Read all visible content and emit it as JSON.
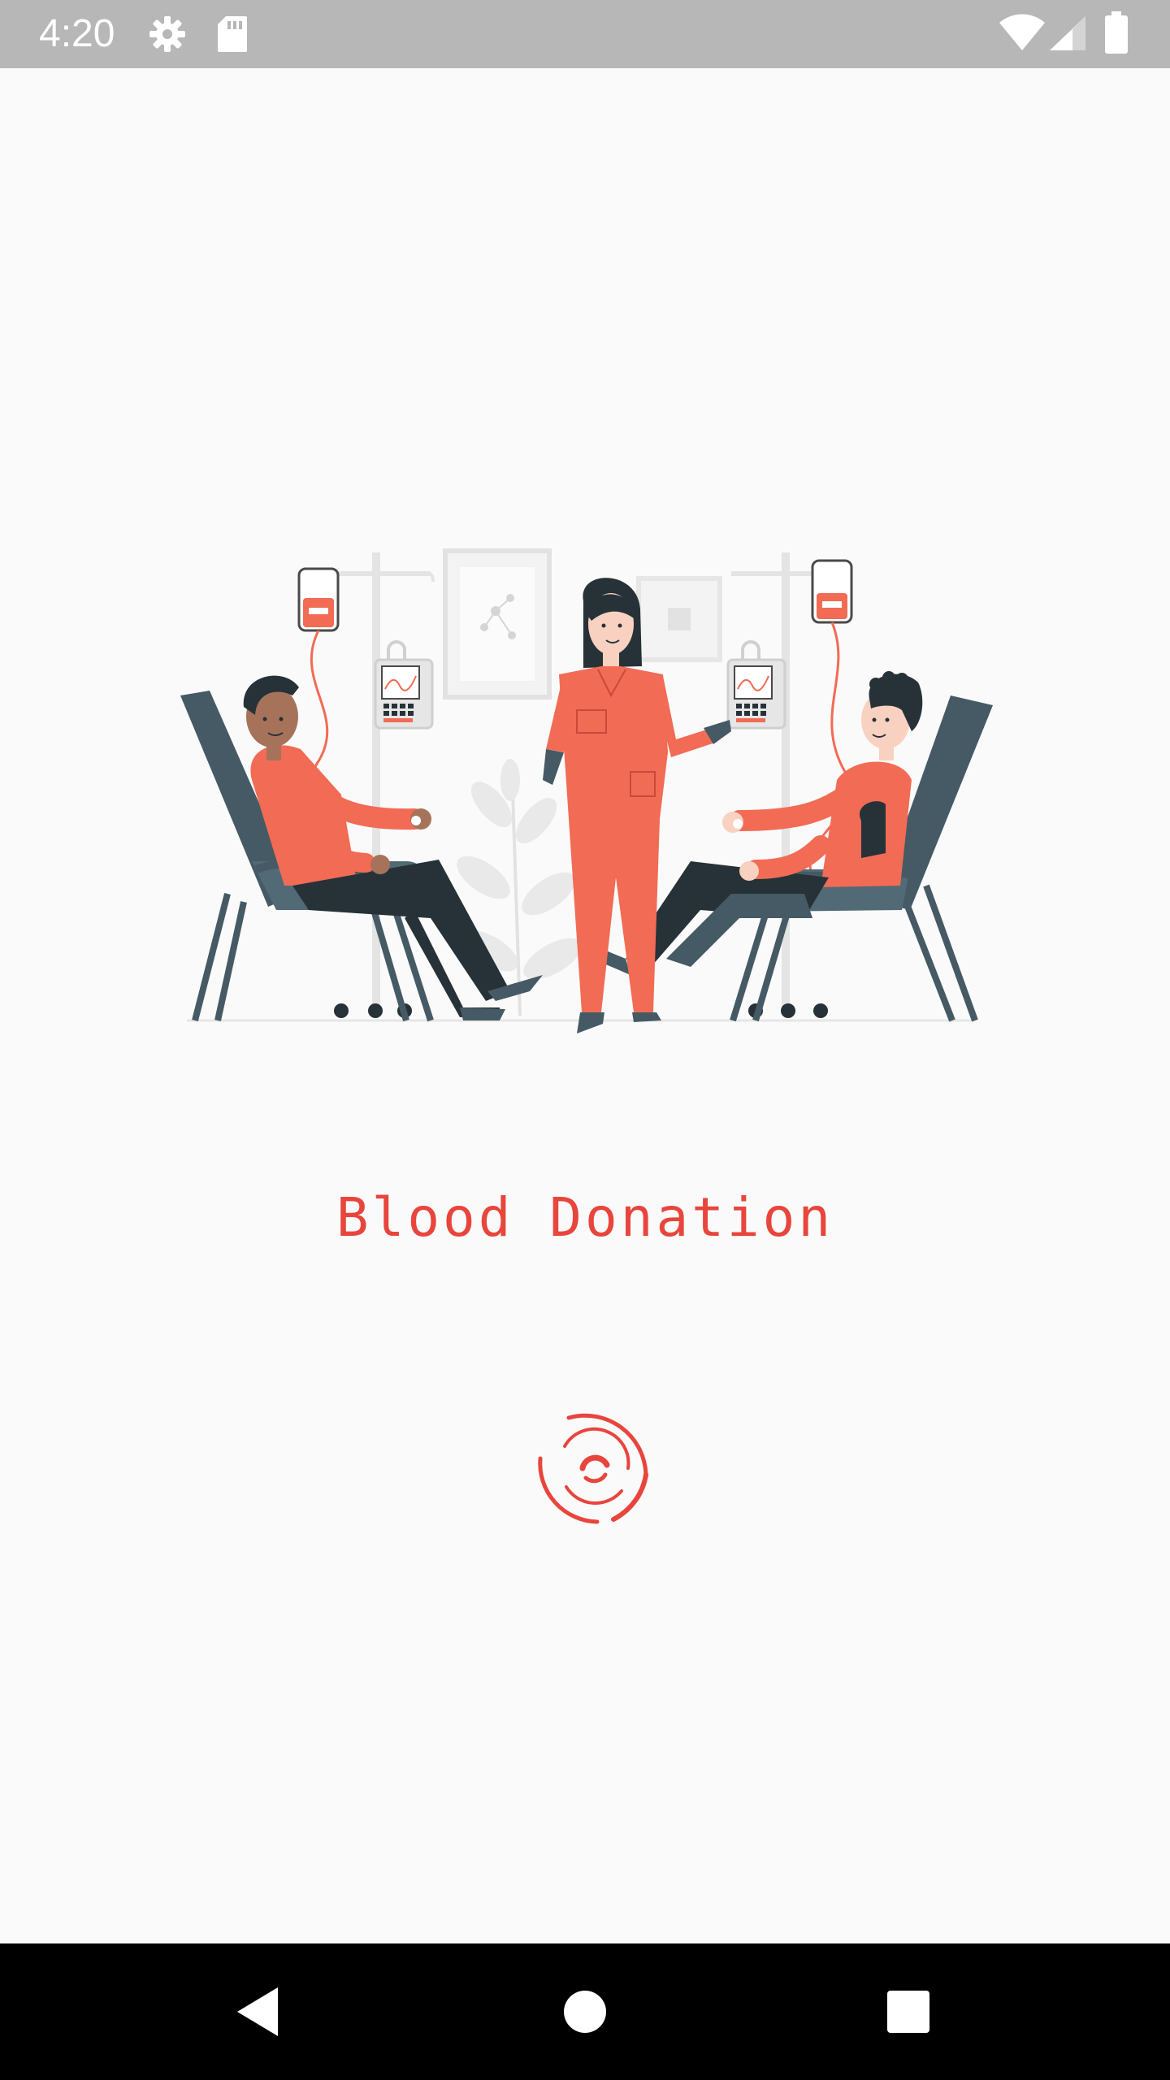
{
  "status_bar": {
    "time": "4:20",
    "icons": [
      "gear-icon",
      "sd-card-icon",
      "wifi-icon",
      "signal-icon",
      "battery-icon"
    ],
    "background": "#b7b7b7"
  },
  "splash": {
    "title": "Blood Donation",
    "title_color": "#e8453c",
    "illustration": "blood-donation-illustration",
    "loader": "loading-spinner-icon"
  },
  "nav_bar": {
    "buttons": [
      "back-icon",
      "home-icon",
      "recents-icon"
    ]
  },
  "colors": {
    "accent": "#e8453c",
    "coral": "#f26b55",
    "chair": "#455a64",
    "dark": "#263238",
    "background": "#fafafa"
  }
}
